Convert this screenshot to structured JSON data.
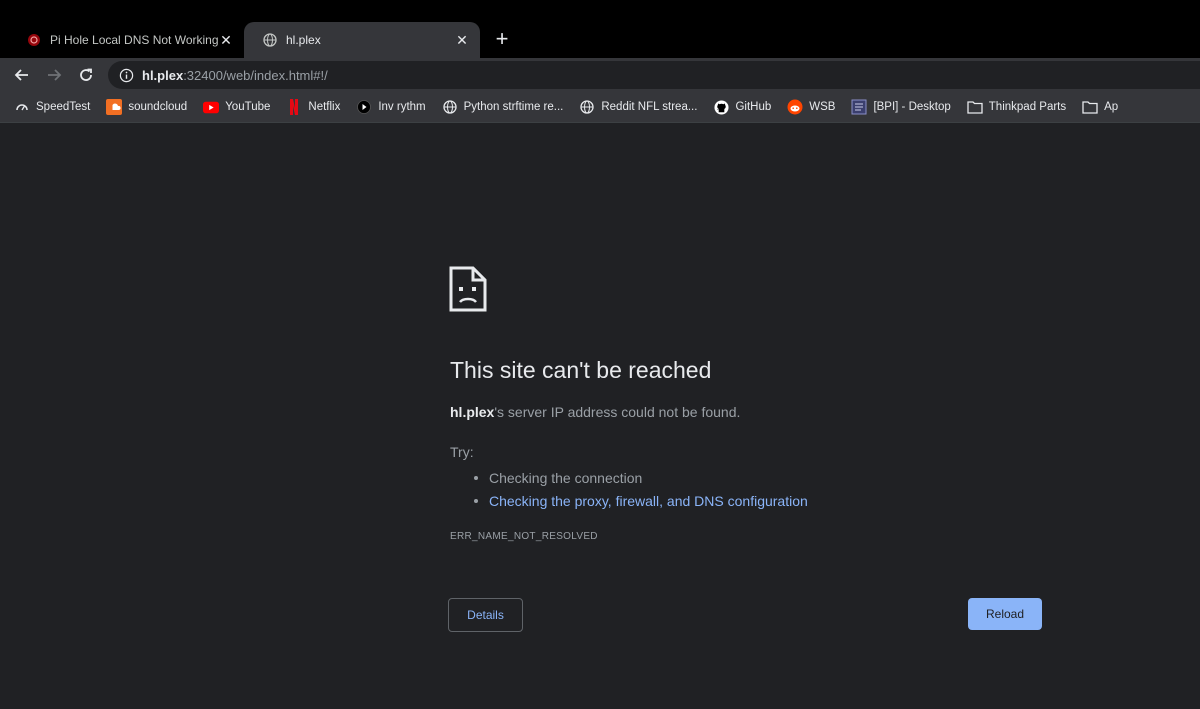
{
  "tabs": [
    {
      "title": "Pi Hole Local DNS Not Working",
      "close_glyph": "✕",
      "favicon": "pihole-icon"
    },
    {
      "title": "hl.plex",
      "close_glyph": "✕",
      "favicon": "globe-icon"
    }
  ],
  "new_tab_glyph": "+",
  "address_bar": {
    "host": "hl.plex",
    "rest": ":32400/web/index.html#!/"
  },
  "bookmarks": [
    {
      "label": "SpeedTest",
      "icon": "speedtest-icon"
    },
    {
      "label": "soundcloud",
      "icon": "soundcloud-icon"
    },
    {
      "label": "YouTube",
      "icon": "youtube-icon"
    },
    {
      "label": "Netflix",
      "icon": "netflix-icon"
    },
    {
      "label": "Inv rythm",
      "icon": "rythm-icon"
    },
    {
      "label": "Python strftime re...",
      "icon": "globe-icon"
    },
    {
      "label": "Reddit NFL strea...",
      "icon": "globe-icon"
    },
    {
      "label": "GitHub",
      "icon": "github-icon"
    },
    {
      "label": "WSB",
      "icon": "reddit-icon"
    },
    {
      "label": "[BPI] - Desktop",
      "icon": "page-icon"
    },
    {
      "label": "Thinkpad Parts",
      "icon": "folder-icon"
    },
    {
      "label": "Ap",
      "icon": "folder-icon"
    }
  ],
  "error": {
    "heading": "This site can't be reached",
    "host": "hl.plex",
    "description_suffix": "'s server IP address could not be found.",
    "try_label": "Try:",
    "suggestion_1": "Checking the connection",
    "suggestion_2": "Checking the proxy, firewall, and DNS configuration",
    "code": "ERR_NAME_NOT_RESOLVED",
    "details_label": "Details",
    "reload_label": "Reload"
  },
  "colors": {
    "background": "#202124",
    "toolbar": "#35363a",
    "link": "#8ab4f8",
    "text_secondary": "#9aa0a6"
  }
}
